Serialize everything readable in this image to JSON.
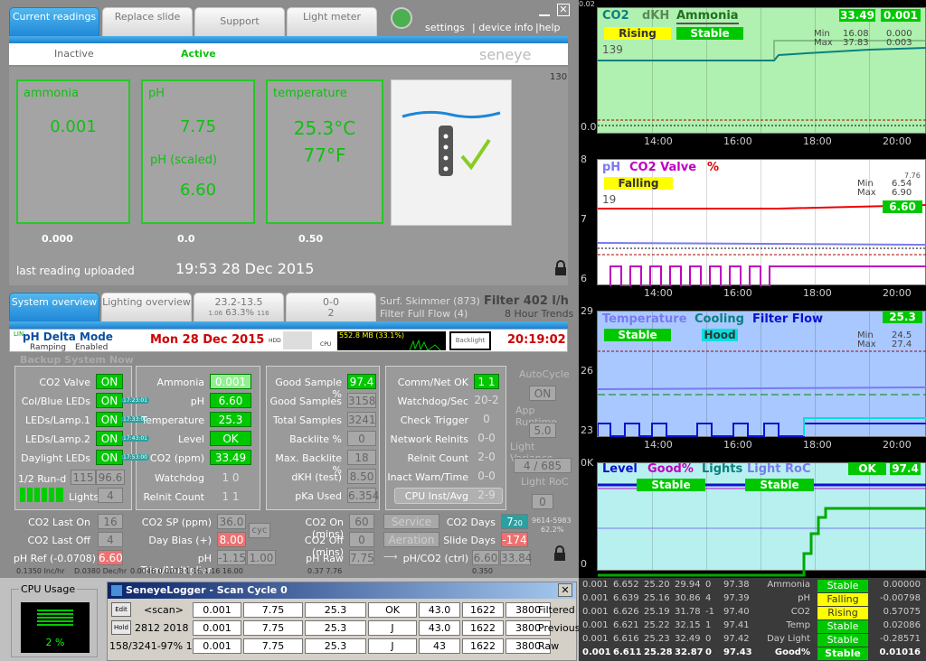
{
  "top_tabs": [
    "Current readings",
    "Replace slide",
    "Support",
    "Light meter"
  ],
  "top_links": {
    "settings": "settings",
    "device_info": "| device info",
    "help": "|help"
  },
  "sub_tabs": {
    "inactive": "Inactive",
    "active": "Active"
  },
  "brand": "seneye",
  "cards": {
    "ammonia": {
      "title": "ammonia",
      "value": "0.001",
      "below": "0.000"
    },
    "ph": {
      "title": "pH",
      "value": "7.75",
      "scaled_label": "pH (scaled)",
      "scaled_value": "6.60",
      "below": "0.0"
    },
    "temp": {
      "title": "temperature",
      "c": "25.3°C",
      "f": "77°F",
      "below": "0.50"
    }
  },
  "side_num": "130",
  "last_upload_label": "last reading uploaded",
  "last_upload_time": "19:53 28 Dec 2015",
  "mid_tabs": [
    "System overview",
    "Lighting overview"
  ],
  "mid_tab3": {
    "top": "23.2-13.5",
    "pct": "63.3%",
    "sub_l": "1.06",
    "sub_r": "116"
  },
  "mid_tab4": {
    "top": "0-0",
    "bottom": "2"
  },
  "surf": {
    "l1": "Surf. Skimmer (873)",
    "l2": "Filter Full Flow (4)",
    "filter": "Filter 402 l/h",
    "trend": "8 Hour Trends"
  },
  "status": {
    "lin": "LIN",
    "mode": "pH Delta Mode",
    "ramping": "Ramping",
    "enabled": "Enabled",
    "date": "Mon 28 Dec 2015",
    "time": "20:19:02",
    "hdd": "HDD",
    "cpu": "CPU",
    "mem": "552.8 MB (33.1%)",
    "backlight": "Backlight"
  },
  "backup": "Backup System Now",
  "sec1": [
    {
      "label": "CO2 Valve",
      "v": "ON"
    },
    {
      "label": "Col/Blue LEDs",
      "v": "ON",
      "t": "17:23:01"
    },
    {
      "label": "LEDs/Lamp.1",
      "v": "ON",
      "t": "17:33:00"
    },
    {
      "label": "LEDs/Lamp.2",
      "v": "ON",
      "t": "17:43:01"
    },
    {
      "label": "Daylight LEDs",
      "v": "ON",
      "t": "17:53:00"
    }
  ],
  "sec1_extra": {
    "runtime_label": "1/2 Run-d",
    "r1": "115",
    "r2": "96.6",
    "lights_label": "Lights",
    "lights": "4"
  },
  "sec2": [
    {
      "label": "Ammonia",
      "v": "0.001"
    },
    {
      "label": "pH",
      "v": "6.60"
    },
    {
      "label": "Temperature",
      "v": "25.3"
    },
    {
      "label": "Level",
      "v": "OK"
    },
    {
      "label": "CO2 (ppm)",
      "v": "33.49"
    }
  ],
  "sec2_extra": [
    {
      "label": "Watchdog",
      "v": "1 0"
    },
    {
      "label": "Relnit Count",
      "v": "1 1"
    }
  ],
  "sec3": [
    {
      "label": "Good Sample %",
      "v": "97.4",
      "green": true
    },
    {
      "label": "Good Samples",
      "v": "3158"
    },
    {
      "label": "Total Samples",
      "v": "3241"
    },
    {
      "label": "Backlite %",
      "v": "0"
    },
    {
      "label": "Max. Backlite %",
      "v": "18"
    },
    {
      "label": "dKH (test)",
      "v": "8.50"
    },
    {
      "label": "pKa Used",
      "v": "6.354"
    }
  ],
  "sec4": [
    {
      "label": "Comm/Net OK",
      "v": "1 1",
      "green": true
    },
    {
      "label": "Watchdog/Sec",
      "v": "20-2"
    },
    {
      "label": "Check Trigger",
      "v": "0"
    },
    {
      "label": "Network Relnits",
      "v": "0-0"
    },
    {
      "label": "Relnit Count",
      "v": "2-0"
    },
    {
      "label": "Inact Warn/Time",
      "v": "0-0"
    },
    {
      "label": "CPU Inst/Avg",
      "v": "2-9"
    }
  ],
  "sec5": {
    "autocycle": "AutoCycle",
    "autocycle_v": "ON",
    "runtime": "App Runtime",
    "runtime_v": "5.0",
    "lightvar": "Light Variance",
    "lightvar_v": "4 / 685",
    "lightroc": "Light RoC",
    "lightroc_v": "0"
  },
  "row_bottom": [
    {
      "l": "CO2 Last On",
      "v": "16"
    },
    {
      "l": "CO2 SP (ppm)",
      "v": "36.0"
    },
    {
      "l": "CO2 On (mins)",
      "v": "60"
    },
    {
      "l": "CO2 Days",
      "v": "7"
    },
    {
      "l": "CO2 Last Off",
      "v": "4"
    },
    {
      "l": "Day Bias (+)",
      "v": "8.00"
    },
    {
      "l": "CO2 Off (mins)",
      "v": "0"
    },
    {
      "l": "Slide Days",
      "v": "-174"
    }
  ],
  "service": "Service",
  "aeration": "Aeration",
  "cyc": "cyc",
  "co2days_sub": "20",
  "co2days_r": "9614-5983",
  "co2days_r2": "62.2%",
  "ph_ref": {
    "l": "pH Ref (-0.0708)",
    "v": "6.60"
  },
  "ph_trim": {
    "l": "pH Trim/Multiplier",
    "v1": "-1.15",
    "v2": "1.00"
  },
  "ph_raw": {
    "l": "pH Raw",
    "v": "7.75"
  },
  "ph_co2": {
    "l": "pH/CO2 (ctrl)",
    "v1": "6.60",
    "v2": "33.84"
  },
  "foot": {
    "a": "0.1350 Inc/hr",
    "b": "D.0380 Dec/hr",
    "c": "0.0046 0.0013 1.16/1.16 16.00",
    "d": "0.37  7.76",
    "e": "0.350"
  },
  "cpu_usage": {
    "title": "CPU Usage",
    "value": "2 %"
  },
  "logger": {
    "title": "SeneyeLogger - Scan Cycle 0",
    "edit": "Edit",
    "hold": "Hold",
    "scan": "<scan>",
    "mid1": "2812 2018",
    "mid2": "158/3241-97% 1",
    "rows": [
      [
        "0.001",
        "7.75",
        "25.3",
        "OK",
        "43.0",
        "1622",
        "3800",
        "Filtered"
      ],
      [
        "0.001",
        "7.75",
        "25.3",
        "J",
        "43.0",
        "1622",
        "3800",
        "Previous"
      ],
      [
        "0.001",
        "7.75",
        "25.3",
        "J",
        "43",
        "1622",
        "3800",
        "Raw"
      ]
    ]
  },
  "table": {
    "rows": [
      [
        "0.001",
        "6.652",
        "25.20",
        "29.94",
        "0",
        "97.38",
        "Ammonia",
        "Stable",
        "0.00000"
      ],
      [
        "0.001",
        "6.639",
        "25.16",
        "30.86",
        "4",
        "97.39",
        "pH",
        "Falling",
        "-0.00798"
      ],
      [
        "0.001",
        "6.626",
        "25.19",
        "31.78",
        "-1",
        "97.40",
        "CO2",
        "Rising",
        "0.57075"
      ],
      [
        "0.001",
        "6.621",
        "25.22",
        "32.15",
        "1",
        "97.41",
        "Temp",
        "Stable",
        "0.02086"
      ],
      [
        "0.001",
        "6.616",
        "25.23",
        "32.49",
        "0",
        "97.42",
        "Day Light",
        "Stable",
        "-0.28571"
      ],
      [
        "0.001",
        "6.611",
        "25.28",
        "32.87",
        "0",
        "97.43",
        "Good%",
        "Stable",
        "0.01016"
      ]
    ]
  },
  "chart_data": [
    {
      "type": "line",
      "title": "CO2 dKH Ammonia",
      "series": [
        {
          "name": "CO2"
        },
        {
          "name": "dKH"
        },
        {
          "name": "Ammonia"
        }
      ],
      "value": "33.49",
      "value2": "0.001",
      "trend": "Rising",
      "trend2": "Stable",
      "side": "139",
      "min_label": "Min",
      "max_label": "Max",
      "min": "16.08",
      "max": "37.83",
      "min2": "0.000",
      "max2": "0.003",
      "yticks": [
        "0.0"
      ],
      "xticks": [
        "14:00",
        "16:00",
        "18:00",
        "20:00"
      ],
      "top_tick": "0.02"
    },
    {
      "type": "line",
      "title": "pH CO2 Valve %",
      "series": [
        {
          "name": "pH"
        },
        {
          "name": "CO2 Valve"
        },
        {
          "name": "%"
        }
      ],
      "value": "6.60",
      "trend": "Falling",
      "side": "19",
      "min_label": "Min",
      "max_label": "Max",
      "min": "6.54",
      "max": "6.90",
      "top": "7.76",
      "yticks": [
        "8",
        "7",
        "6"
      ],
      "xticks": [
        "14:00",
        "16:00",
        "18:00",
        "20:00"
      ]
    },
    {
      "type": "line",
      "title": "Temperature Cooling Filter Flow",
      "series": [
        {
          "name": "Temperature"
        },
        {
          "name": "Cooling"
        },
        {
          "name": "Filter Flow"
        }
      ],
      "value": "25.3",
      "trend": "Stable",
      "trend2": "Hood",
      "min_label": "Min",
      "max_label": "Max",
      "min": "24.5",
      "max": "27.4",
      "yticks": [
        "29",
        "26",
        "23"
      ],
      "xticks": [
        "14:00",
        "16:00",
        "18:00",
        "20:00"
      ]
    },
    {
      "type": "line",
      "title": "Level Good% Lights Light RoC",
      "series": [
        {
          "name": "Level"
        },
        {
          "name": "Good%"
        },
        {
          "name": "Lights"
        },
        {
          "name": "Light RoC"
        }
      ],
      "value": "OK",
      "value2": "97.4",
      "trend": "Stable",
      "trend2": "Stable",
      "yticks": [
        "0K",
        "0"
      ]
    }
  ]
}
